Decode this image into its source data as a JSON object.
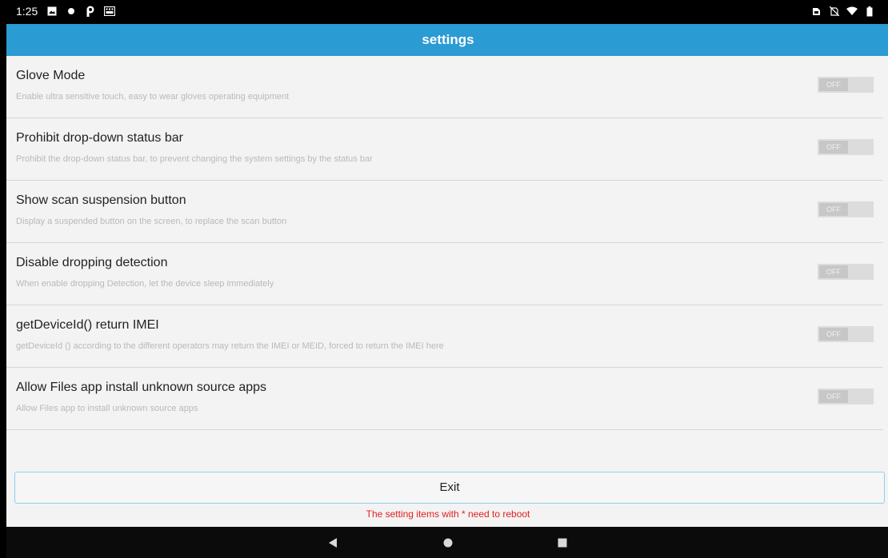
{
  "status_bar": {
    "time": "1:25",
    "left_icons": [
      "image-icon",
      "dot-icon",
      "p-icon",
      "keyboard-icon"
    ],
    "right_icons": [
      "sim-icon",
      "no-sim-icon",
      "wifi-icon",
      "battery-icon"
    ]
  },
  "header": {
    "title": "settings",
    "color": "#2b9bd3"
  },
  "settings": [
    {
      "title": "Glove Mode",
      "description": "Enable ultra sensitive touch, easy to wear gloves operating equipment",
      "toggle_label": "OFF",
      "state": "off"
    },
    {
      "title": "Prohibit drop-down status bar",
      "description": "Prohibit the drop-down status bar, to prevent changing the system settings by the status bar",
      "toggle_label": "OFF",
      "state": "off"
    },
    {
      "title": "Show scan suspension button",
      "description": "Display a suspended button on the screen, to replace the scan button",
      "toggle_label": "OFF",
      "state": "off"
    },
    {
      "title": "Disable dropping detection",
      "description": "When enable dropping Detection, let the device sleep immediately",
      "toggle_label": "OFF",
      "state": "off"
    },
    {
      "title": "getDeviceId() return IMEI",
      "description": "getDeviceId () according to the different operators may return the IMEI or MEID, forced to return the IMEI here",
      "toggle_label": "OFF",
      "state": "off"
    },
    {
      "title": "Allow Files app install unknown source apps",
      "description": "Allow Files app to install unknown source apps",
      "toggle_label": "OFF",
      "state": "off"
    }
  ],
  "footer": {
    "exit_label": "Exit",
    "reboot_note": "The setting items with * need to reboot",
    "note_color": "#e21f1f"
  },
  "nav_bar": {
    "buttons": [
      "back-icon",
      "home-icon",
      "recents-icon"
    ]
  }
}
